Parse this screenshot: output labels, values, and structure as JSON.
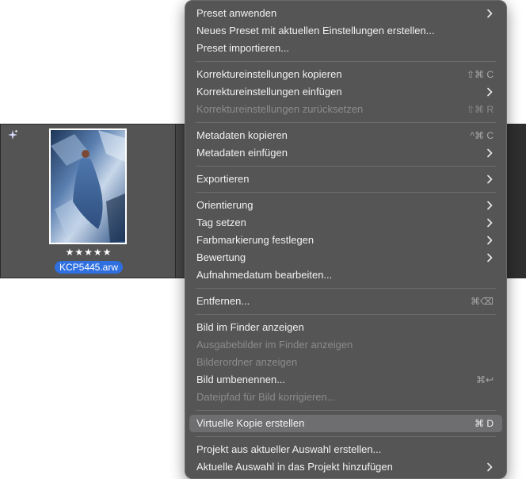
{
  "filmstrip": {
    "rating_stars": "★★★★★",
    "filename": "KCP5445.arw"
  },
  "menu": {
    "items": [
      {
        "label": "Preset anwenden",
        "shortcut": "",
        "submenu": true,
        "disabled": false
      },
      {
        "label": "Neues Preset mit aktuellen Einstellungen erstellen...",
        "shortcut": "",
        "submenu": false,
        "disabled": false
      },
      {
        "label": "Preset importieren...",
        "shortcut": "",
        "submenu": false,
        "disabled": false
      },
      {
        "label": "Korrektureinstellungen kopieren",
        "shortcut": "⇧⌘ C",
        "submenu": false,
        "disabled": false
      },
      {
        "label": "Korrektureinstellungen einfügen",
        "shortcut": "",
        "submenu": true,
        "disabled": false
      },
      {
        "label": "Korrektureinstellungen zurücksetzen",
        "shortcut": "⇧⌘ R",
        "submenu": false,
        "disabled": true
      },
      {
        "label": "Metadaten kopieren",
        "shortcut": "^⌘ C",
        "submenu": false,
        "disabled": false
      },
      {
        "label": "Metadaten einfügen",
        "shortcut": "",
        "submenu": true,
        "disabled": false
      },
      {
        "label": "Exportieren",
        "shortcut": "",
        "submenu": true,
        "disabled": false
      },
      {
        "label": "Orientierung",
        "shortcut": "",
        "submenu": true,
        "disabled": false
      },
      {
        "label": "Tag setzen",
        "shortcut": "",
        "submenu": true,
        "disabled": false
      },
      {
        "label": "Farbmarkierung festlegen",
        "shortcut": "",
        "submenu": true,
        "disabled": false
      },
      {
        "label": "Bewertung",
        "shortcut": "",
        "submenu": true,
        "disabled": false
      },
      {
        "label": "Aufnahmedatum bearbeiten...",
        "shortcut": "",
        "submenu": false,
        "disabled": false
      },
      {
        "label": "Entfernen...",
        "shortcut": "⌘⌫",
        "submenu": false,
        "disabled": false
      },
      {
        "label": "Bild im Finder anzeigen",
        "shortcut": "",
        "submenu": false,
        "disabled": false
      },
      {
        "label": "Ausgabebilder im Finder anzeigen",
        "shortcut": "",
        "submenu": false,
        "disabled": true
      },
      {
        "label": "Bilderordner anzeigen",
        "shortcut": "",
        "submenu": false,
        "disabled": true
      },
      {
        "label": "Bild umbenennen...",
        "shortcut": "⌘↩",
        "submenu": false,
        "disabled": false
      },
      {
        "label": "Dateipfad für Bild korrigieren...",
        "shortcut": "",
        "submenu": false,
        "disabled": true
      },
      {
        "label": "Virtuelle Kopie erstellen",
        "shortcut": "⌘ D",
        "submenu": false,
        "disabled": false,
        "highlighted": true
      },
      {
        "label": "Projekt aus aktueller Auswahl erstellen...",
        "shortcut": "",
        "submenu": false,
        "disabled": false
      },
      {
        "label": "Aktuelle Auswahl in das Projekt hinzufügen",
        "shortcut": "",
        "submenu": true,
        "disabled": false
      }
    ]
  }
}
